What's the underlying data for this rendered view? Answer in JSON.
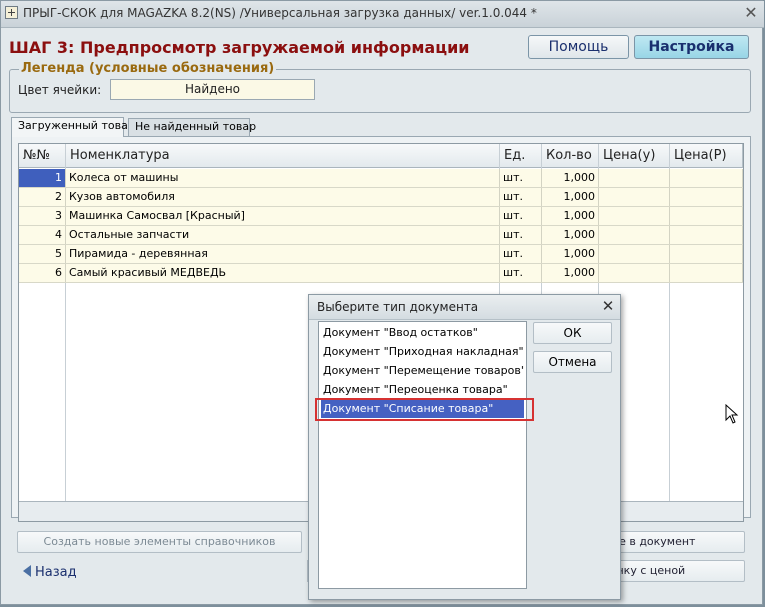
{
  "window": {
    "title": "ПРЫГ-СКОК для MAGAZKA 8.2(NS)  /Универсальная загрузка данных/ ver.1.0.044 *",
    "close_glyph": "✕"
  },
  "header": {
    "step_title": "ШАГ 3: Предпросмотр загружаемой информации",
    "help_label": "Помощь",
    "settings_label": "Настройка"
  },
  "legend": {
    "title": "Легенда (условные обозначения)",
    "cell_color_label": "Цвет ячейки:",
    "cell_color_value": "Найдено",
    "cell_color_hex": "#fbf9e6"
  },
  "tabs": [
    {
      "label": "Загруженный товар",
      "active": true
    },
    {
      "label": "Не найденный товар",
      "active": false
    }
  ],
  "grid": {
    "columns": [
      "№№",
      "Номенклатура",
      "Ед.",
      "Кол-во",
      "Цена(у)",
      "Цена(Р)"
    ],
    "rows": [
      {
        "n": "1",
        "name": "Колеса от машины",
        "unit": "шт.",
        "qty": "1,000",
        "selected": true
      },
      {
        "n": "2",
        "name": "Кузов автомобиля",
        "unit": "шт.",
        "qty": "1,000",
        "selected": false
      },
      {
        "n": "3",
        "name": "Машинка Самосвал [Красный]",
        "unit": "шт.",
        "qty": "1,000",
        "selected": false
      },
      {
        "n": "4",
        "name": "Остальные запчасти",
        "unit": "шт.",
        "qty": "1,000",
        "selected": false
      },
      {
        "n": "5",
        "name": "Пирамида - деревянная",
        "unit": "шт.",
        "qty": "1,000",
        "selected": false
      },
      {
        "n": "6",
        "name": "Самый красивый МЕДВЕДЬ",
        "unit": "шт.",
        "qty": "1,000",
        "selected": false
      }
    ]
  },
  "bottom": {
    "create_label": "Создать новые элементы справочников",
    "add_label_visible": "нные в документ",
    "price_label_visible": "олонку с ценой",
    "back_label": "Назад"
  },
  "dialog": {
    "title": "Выберите тип документа",
    "close_glyph": "✕",
    "items": [
      "Документ \"Ввод остатков\"",
      "Документ \"Приходная накладная\"",
      "Документ \"Перемещение товаров\"",
      "Документ \"Переоценка товара\"",
      "Документ \"Списание товара\""
    ],
    "selected_index": 4,
    "ok_label": "ОК",
    "cancel_label": "Отмена"
  },
  "colors": {
    "title_red": "#8b0f0f",
    "legend_gold": "#9a6a10",
    "selection_blue": "#4561c2",
    "highlight_red": "#d63232"
  }
}
